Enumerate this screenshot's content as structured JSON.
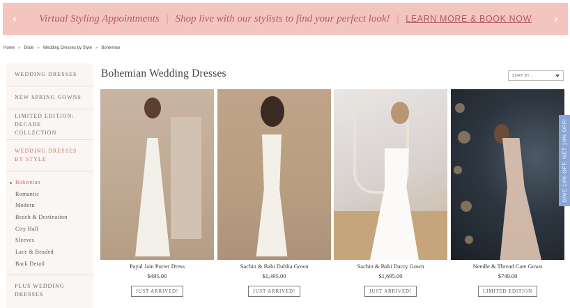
{
  "banner": {
    "text": "Virtual Styling Appointments",
    "text2": "Shop live with our stylists to find your perfect look!",
    "separator": "|",
    "link": "LEARN MORE & BOOK NOW",
    "prev": "‹",
    "next": "›",
    "background": "#f4c5bf"
  },
  "breadcrumb": {
    "items": [
      "Home",
      "Bride",
      "Wedding Dresses by Style",
      "Bohemian"
    ],
    "separator": "»"
  },
  "sidebar": {
    "items": [
      {
        "label": "WEDDING DRESSES"
      },
      {
        "label": "NEW SPRING GOWNS"
      },
      {
        "label": "LIMITED EDITION: DECADE COLLECTION"
      },
      {
        "label": "WEDDING DRESSES BY STYLE"
      },
      {
        "label": "PLUS WEDDING DRESSES"
      }
    ],
    "subitems": [
      "Bohemian",
      "Romantic",
      "Modern",
      "Beach & Destination",
      "City Hall",
      "Sleeves",
      "Lace & Beaded",
      "Back Detail"
    ],
    "active_color": "#c9736b"
  },
  "page": {
    "title": "Bohemian Wedding Dresses",
    "sort_label": "SORT BY..."
  },
  "products": [
    {
      "name": "Payal Jain Porter Dress",
      "price": "$495.00",
      "badge": "JUST ARRIVED!"
    },
    {
      "name": "Sachin & Babi Dahlia Gown",
      "price": "$1,495.00",
      "badge": "JUST ARRIVED!"
    },
    {
      "name": "Sachin & Babi Darcy Gown",
      "price": "$1,695.00",
      "badge": "JUST ARRIVED!"
    },
    {
      "name": "Needle & Thread Cate Gown",
      "price": "$749.00",
      "badge": "LIMITED EDITION"
    }
  ],
  "side_tab": {
    "text": "GIVE 10% OFF, GET 10% OFF!",
    "color": "#8ba6d4"
  }
}
